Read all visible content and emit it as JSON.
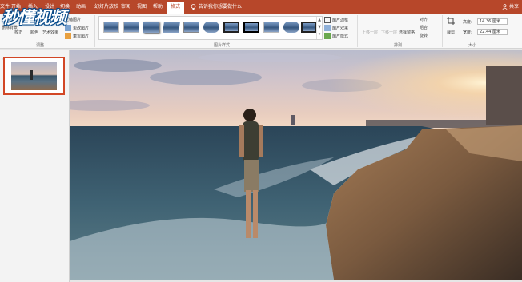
{
  "watermark": {
    "text": "秒懂视频"
  },
  "tabs": [
    {
      "label": "文件"
    },
    {
      "label": "开始"
    },
    {
      "label": "插入"
    },
    {
      "label": "设计"
    },
    {
      "label": "切换"
    },
    {
      "label": "动画"
    },
    {
      "label": "幻灯片放映"
    },
    {
      "label": "审阅"
    },
    {
      "label": "视图"
    },
    {
      "label": "帮助"
    },
    {
      "label": "格式"
    }
  ],
  "active_tab": "格式",
  "tell_me": {
    "placeholder": "告诉我你想要做什么"
  },
  "share": {
    "label": "共享"
  },
  "ribbon": {
    "adjust": {
      "remove_bg": "删除背景",
      "corrections": "校正",
      "color": "颜色",
      "artistic": "艺术效果",
      "compress": "压缩图片",
      "change": "更改图片",
      "reset": "重设图片",
      "group_label": "调整"
    },
    "styles": {
      "border": "图片边框",
      "effects": "图片效果",
      "layout": "图片版式",
      "group_label": "图片样式"
    },
    "arrange": {
      "bring_forward": "上移一层",
      "send_backward": "下移一层",
      "selection_pane": "选择窗格",
      "align": "对齐",
      "group": "组合",
      "rotate": "旋转",
      "group_label": "排列"
    },
    "size": {
      "crop": "裁剪",
      "height_label": "高度:",
      "height_value": "14.36 厘米",
      "width_label": "宽度:",
      "width_value": "22.44 厘米",
      "group_label": "大小"
    }
  },
  "slides": [
    {
      "number": "1"
    }
  ],
  "icons": [
    "search-icon",
    "lightbulb-icon",
    "user-icon",
    "crop-icon",
    "dropdown-icon"
  ]
}
